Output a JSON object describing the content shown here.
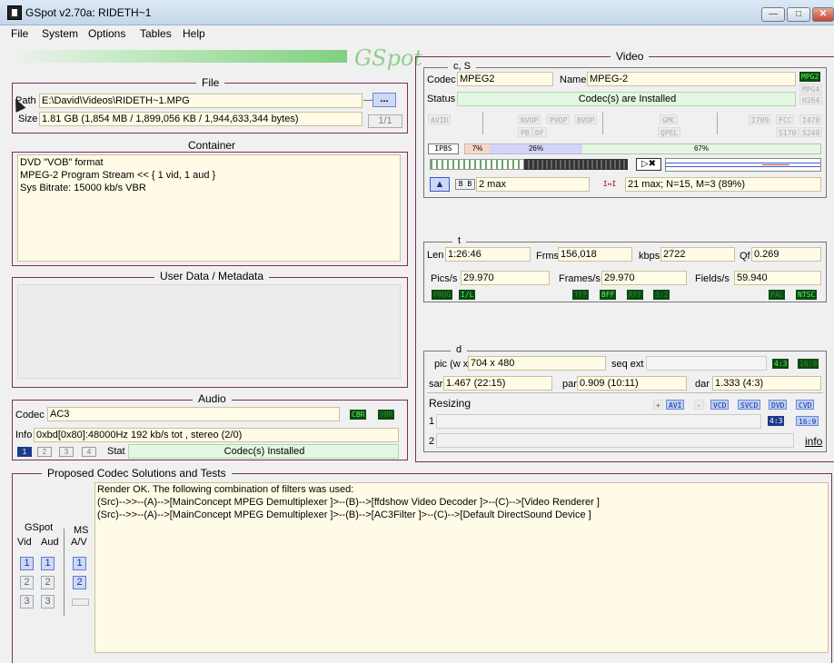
{
  "window": {
    "title": "GSpot v2.70a: RIDETH~1"
  },
  "menu": [
    "File",
    "System",
    "Options",
    "Tables",
    "Help"
  ],
  "logo": "GSpot",
  "file": {
    "legend": "File",
    "path_label": "Path",
    "path": "E:\\David\\Videos\\RIDETH~1.MPG",
    "browse": "...",
    "size_label": "Size",
    "size": "1.81 GB (1,854 MB / 1,899,056 KB / 1,944,633,344 bytes)",
    "page": "1/1"
  },
  "container": {
    "legend": "Container",
    "lines": [
      "DVD \"VOB\" format",
      "MPEG-2 Program Stream << { 1 vid, 1 aud }",
      "Sys Bitrate: 15000 kb/s VBR"
    ]
  },
  "userdata": {
    "legend": "User Data / Metadata"
  },
  "audio": {
    "legend": "Audio",
    "codec_label": "Codec",
    "codec": "AC3",
    "cbr": "CBR",
    "vbr": "VBR",
    "info_label": "Info",
    "info": "0xbd[0x80]:48000Hz  192 kb/s tot , stereo (2/0)",
    "tabs": [
      "1",
      "2",
      "3",
      "4"
    ],
    "stat_label": "Stat",
    "stat": "Codec(s) Installed"
  },
  "codecs": {
    "legend": "Proposed Codec Solutions and Tests",
    "gspot_label": "GSpot",
    "ms_label": "MS",
    "vid_label": "Vid",
    "aud_label": "Aud",
    "av_label": "A/V",
    "nums": [
      "1",
      "2",
      "3"
    ],
    "lines": [
      "Render OK.  The following combination of filters was used:",
      "(Src)-->>--(A)-->[MainConcept MPEG Demultiplexer ]>--(B)-->[ffdshow Video Decoder ]>--(C)-->[Video Renderer ]",
      "(Src)-->>--(A)-->[MainConcept MPEG Demultiplexer ]>--(B)-->[AC3Filter ]>--(C)-->[Default DirectSound Device ]"
    ]
  },
  "video": {
    "legend": "Video",
    "cs_legend": "c, S",
    "codec_label": "Codec",
    "codec": "MPEG2",
    "name_label": "Name",
    "name": "MPEG-2",
    "status_label": "Status",
    "status": "Codec(s) are Installed",
    "fmt_badges": [
      "MPG2",
      "MPG4",
      "H264"
    ],
    "flags": {
      "avid": "AVID",
      "nvop": "NVOP",
      "pvop": "PVOP",
      "bvop": "BVOP",
      "gmc": "GMC",
      "pb": "PB",
      "df": "DF",
      "qpel": "QPEL",
      "i709": "I709",
      "fcc": "FCC",
      "i470": "I470",
      "s170": "S170",
      "s240": "S240"
    },
    "ipbs": "IPBS",
    "pct_i": "7%",
    "pct_p": "26%",
    "pct_b": "67%",
    "pct_i_val": 7,
    "pct_p_val": 26,
    "pct_b_val": 67,
    "b_max": "2 max",
    "gop": "21 max; N=15, M=3 (89%)",
    "t_legend": "t",
    "len_label": "Len",
    "len": "1:26:46",
    "frms_label": "Frms",
    "frms": "156,018",
    "kbps_label": "kbps",
    "kbps": "2722",
    "qf_label": "Qf",
    "qf": "0.269",
    "pics_label": "Pics/s",
    "pics": "29.970",
    "frames_label": "Frames/s",
    "frames": "29.970",
    "fields_label": "Fields/s",
    "fields": "59.940",
    "t_badges": [
      "PROG",
      "I/L",
      "TFF",
      "BFF",
      "RFF",
      "3:2",
      "PAL",
      "NTSC"
    ],
    "d_legend": "d",
    "pic_label": "pic (w x",
    "pic": "704 x 480",
    "seqext_label": "seq ext",
    "aspect": [
      "4:3",
      "16:9"
    ],
    "sar_label": "sar",
    "sar": "1.467 (22:15)",
    "par_label": "par",
    "par": "0.909 (10:11)",
    "dar_label": "dar",
    "dar": "1.333 (4:3)",
    "resizing_label": "Resizing",
    "resize_btns": [
      "+",
      "AVI",
      "-",
      "VCD",
      "SVCD",
      "DVD",
      "CVD"
    ],
    "row1": "1",
    "row2": "2",
    "info_link": "info"
  }
}
